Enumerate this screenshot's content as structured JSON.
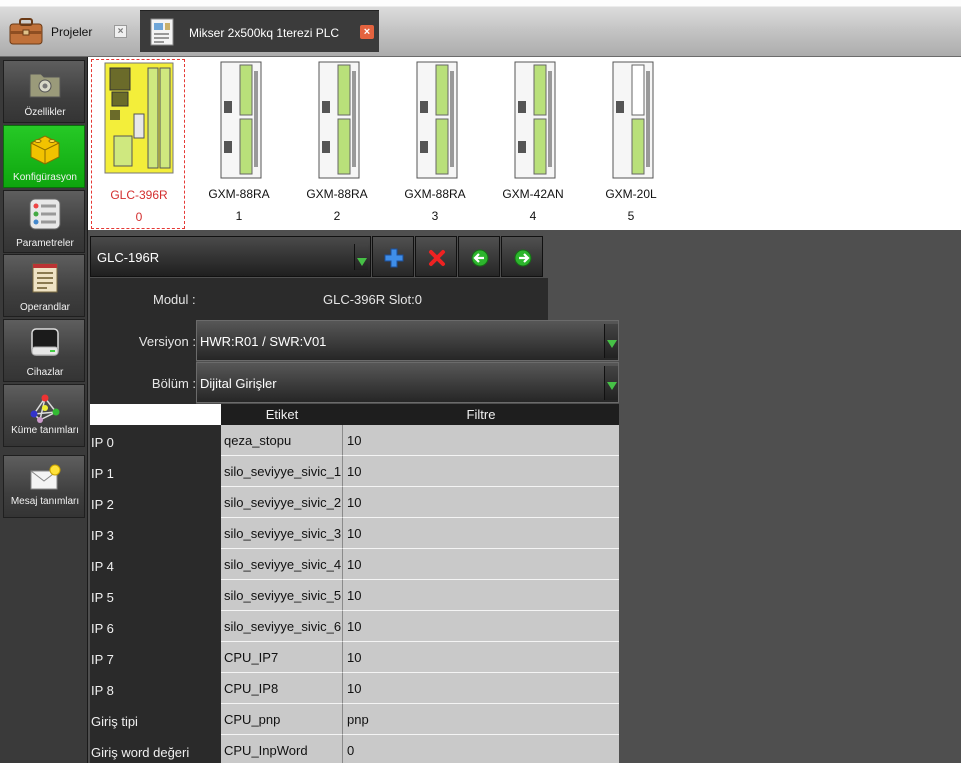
{
  "tabs": {
    "home_label": "Projeler",
    "home_close": "×",
    "doc_label": "Mikser 2x500kq 1terezi PLC",
    "doc_close": "×"
  },
  "sidebar": {
    "items": [
      {
        "label": "Özellikler",
        "icon": "gear-folder-icon"
      },
      {
        "label": "Konfigürasyon",
        "icon": "blocks-icon"
      },
      {
        "label": "Parametreler",
        "icon": "list-icon"
      },
      {
        "label": "Operandlar",
        "icon": "notepad-icon"
      },
      {
        "label": "Cihazlar",
        "icon": "drive-icon"
      },
      {
        "label": "Küme tanımları",
        "icon": "molecule-icon"
      },
      {
        "label": "Mesaj tanımları",
        "icon": "envelope-icon"
      }
    ]
  },
  "modules": [
    {
      "name": "GLC-396R",
      "slot": "0"
    },
    {
      "name": "GXM-88RA",
      "slot": "1"
    },
    {
      "name": "GXM-88RA",
      "slot": "2"
    },
    {
      "name": "GXM-88RA",
      "slot": "3"
    },
    {
      "name": "GXM-42AN",
      "slot": "4"
    },
    {
      "name": "GXM-20L",
      "slot": "5"
    }
  ],
  "toolbar": {
    "module_select_value": "GLC-196R"
  },
  "properties": {
    "modul_label": "Modul :",
    "modul_value": "GLC-396R Slot:0",
    "versiyon_label": "Versiyon :",
    "versiyon_value": "HWR:R01 / SWR:V01",
    "bolum_label": "Bölüm :",
    "bolum_value": "Dijital Girişler"
  },
  "table": {
    "headers": [
      "Etiket",
      "Filtre"
    ],
    "rows": [
      {
        "name": "IP 0",
        "label": "qeza_stopu",
        "filter": "10"
      },
      {
        "name": "IP 1",
        "label": "silo_seviyye_sivic_1",
        "filter": "10"
      },
      {
        "name": "IP 2",
        "label": "silo_seviyye_sivic_2",
        "filter": "10"
      },
      {
        "name": "IP 3",
        "label": "silo_seviyye_sivic_3",
        "filter": "10"
      },
      {
        "name": "IP 4",
        "label": "silo_seviyye_sivic_4",
        "filter": "10"
      },
      {
        "name": "IP 5",
        "label": "silo_seviyye_sivic_5",
        "filter": "10"
      },
      {
        "name": "IP 6",
        "label": "silo_seviyye_sivic_6",
        "filter": "10"
      },
      {
        "name": "IP 7",
        "label": "CPU_IP7",
        "filter": "10"
      },
      {
        "name": "IP 8",
        "label": "CPU_IP8",
        "filter": "10"
      },
      {
        "name": "Giriş tipi",
        "label": "CPU_pnp",
        "filter": "pnp"
      },
      {
        "name": "Giriş word değeri",
        "label": "CPU_InpWord",
        "filter": "0"
      }
    ]
  },
  "colors": {
    "active_green": "#14b214",
    "module_yellow": "#f3ee3a",
    "selection_red": "#e53935"
  }
}
